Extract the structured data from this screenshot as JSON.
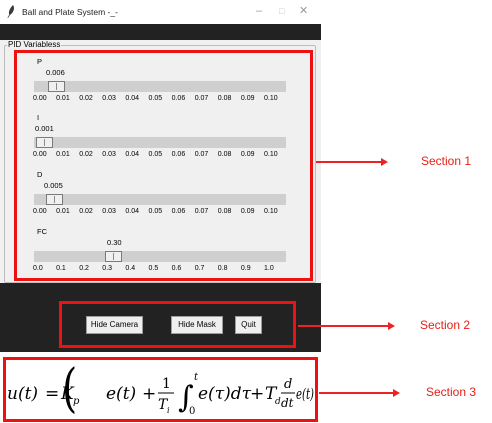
{
  "window": {
    "title": "Ball and Plate System -_-",
    "controls": {
      "minimize": "–",
      "maximize": "□",
      "close": "✕"
    }
  },
  "pid_panel": {
    "group_label": "PID Variabless",
    "sliders": [
      {
        "label": "P",
        "value": "0.006",
        "fraction": 0.06,
        "ticks": [
          "0.00",
          "0.01",
          "0.02",
          "0.03",
          "0.04",
          "0.05",
          "0.06",
          "0.07",
          "0.08",
          "0.09",
          "0.10"
        ]
      },
      {
        "label": "I",
        "value": "0.001",
        "fraction": 0.01,
        "ticks": [
          "0.00",
          "0.01",
          "0.02",
          "0.03",
          "0.04",
          "0.05",
          "0.06",
          "0.07",
          "0.08",
          "0.09",
          "0.10"
        ]
      },
      {
        "label": "D",
        "value": "0.005",
        "fraction": 0.05,
        "ticks": [
          "0.00",
          "0.01",
          "0.02",
          "0.03",
          "0.04",
          "0.05",
          "0.06",
          "0.07",
          "0.08",
          "0.09",
          "0.10"
        ]
      },
      {
        "label": "FC",
        "value": "0.30",
        "fraction": 0.3,
        "ticks": [
          "0.0",
          "0.1",
          "0.2",
          "0.3",
          "0.4",
          "0.5",
          "0.6",
          "0.7",
          "0.8",
          "0.9",
          "1.0"
        ]
      }
    ]
  },
  "buttons": {
    "hide_camera": "Hide Camera",
    "hide_mask": "Hide Mask",
    "quit": "Quit"
  },
  "annotations": {
    "section1": "Section 1",
    "section2": "Section 2",
    "section3": "Section 3",
    "accent_color": "#ee1111"
  },
  "formula": {
    "lhs": "u(t)",
    "equals": "=",
    "kp": "K",
    "kp_sub": "p",
    "e_t": "e(t)",
    "plus": "+",
    "one": "1",
    "ti": "T",
    "ti_sub": "i",
    "int_upper": "t",
    "int_lower": "0",
    "integrand": "e(τ)dτ",
    "td": "T",
    "td_sub": "d",
    "d_num": "d",
    "dt": "dt",
    "e_t2": "e(t)"
  }
}
